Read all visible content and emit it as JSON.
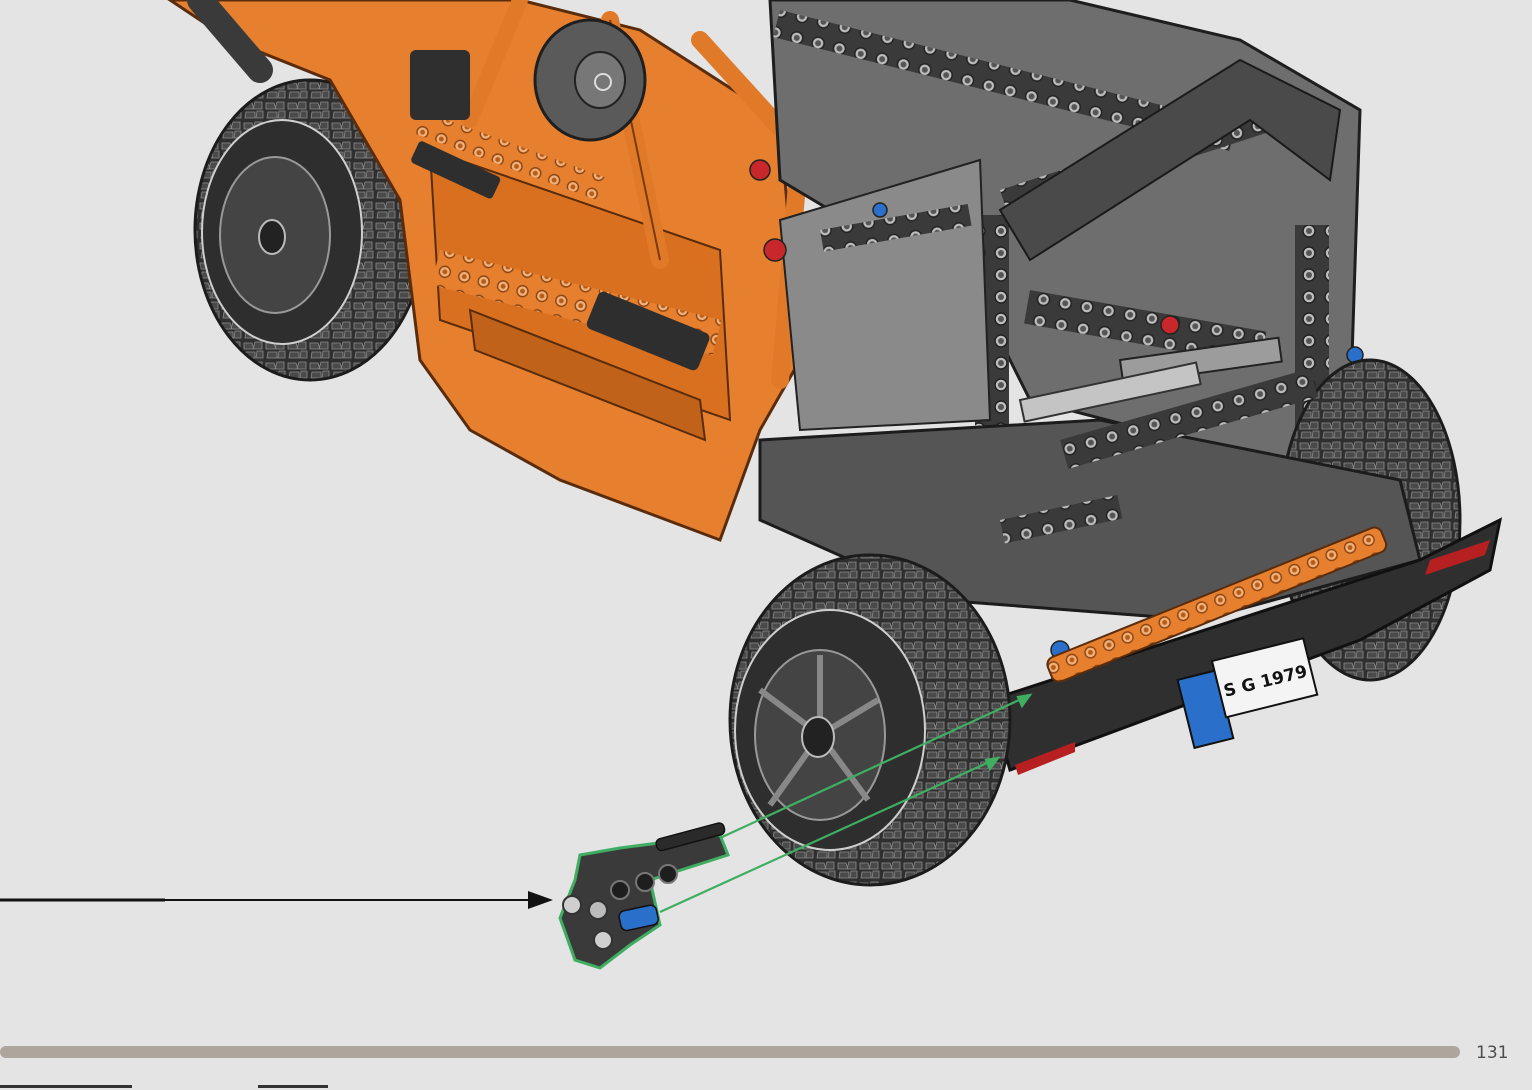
{
  "page": {
    "number": "131",
    "background": "#e4e4e4"
  },
  "model": {
    "plate_text": "S G 1979",
    "colors": {
      "orange": "#e6802f",
      "dark_grey": "#3a3a3a",
      "light_grey": "#a8a8a8",
      "blue": "#2a6fc9",
      "red": "#c8272b",
      "highlight": "#3fae62"
    }
  },
  "callout": {
    "label": ""
  },
  "footer": {
    "bar_color": "#ada69d"
  }
}
